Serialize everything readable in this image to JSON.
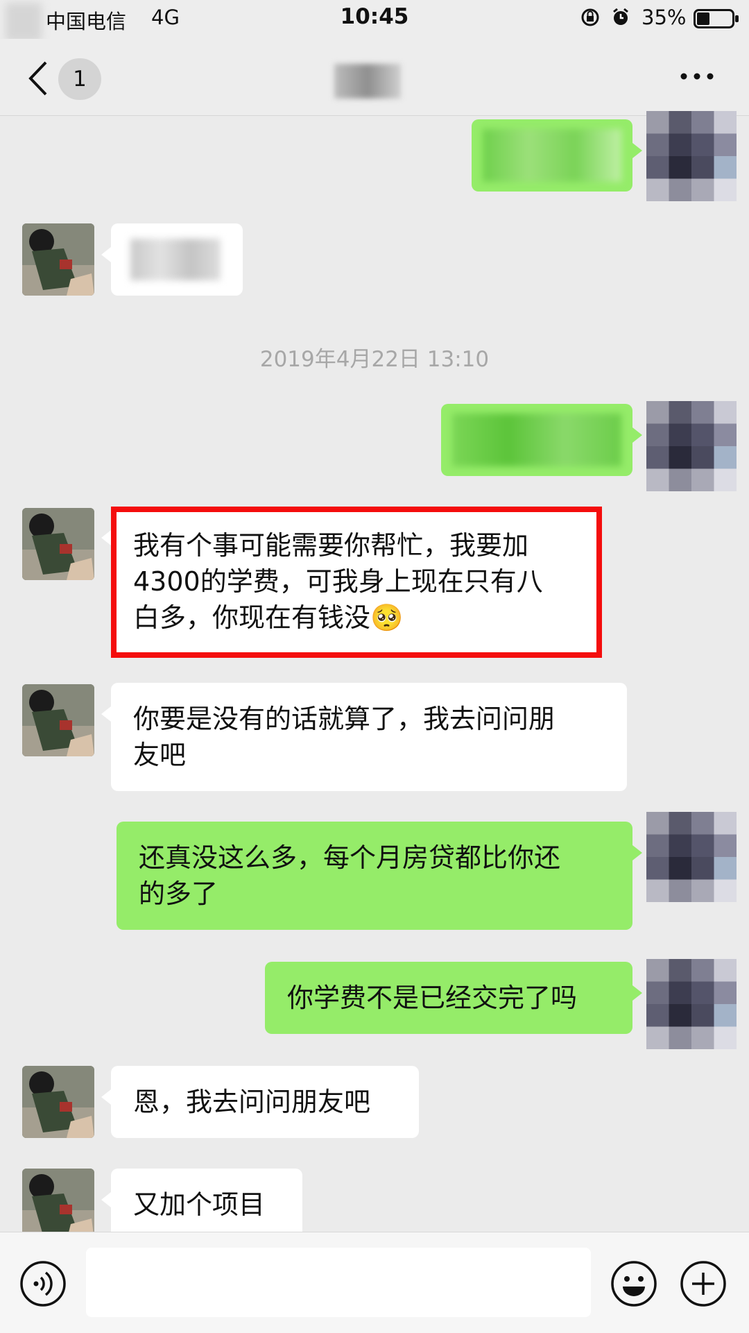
{
  "status_bar": {
    "carrier": "中国电信",
    "network": "4G",
    "time": "10:45",
    "battery": "35%",
    "icons": [
      "orientation-lock-icon",
      "alarm-icon",
      "battery-icon"
    ]
  },
  "nav": {
    "unread_count": "1",
    "icons": [
      "back-arrow-icon",
      "more-icon"
    ]
  },
  "timestamp": "2019年4月22日 13:10",
  "messages": {
    "m5": "我有个事可能需要你帮忙，我要加4300的学费，可我身上现在只有八白多，你现在有钱没",
    "m5_lines": [
      "我有个事可能需要你帮忙，我要加",
      "4300的学费，可我身上现在只有八",
      "白多，你现在有钱没"
    ],
    "m5_emoji": "🥺",
    "m6_lines": [
      "你要是没有的话就算了，我去问问朋",
      "友吧"
    ],
    "m7_lines": [
      "还真没这么多，每个月房贷都比你还",
      "的多了"
    ],
    "m8": "你学费不是已经交完了吗",
    "m9": "恩，我去问问朋友吧",
    "m10": "又加个项目"
  },
  "colors": {
    "background": "#ebebeb",
    "bubble_sent": "#95ec69",
    "bubble_received": "#ffffff",
    "highlight": "#f40d0d"
  },
  "input_bar": {
    "icons": [
      "voice-icon",
      "emoji-icon",
      "plus-icon"
    ],
    "value": ""
  }
}
